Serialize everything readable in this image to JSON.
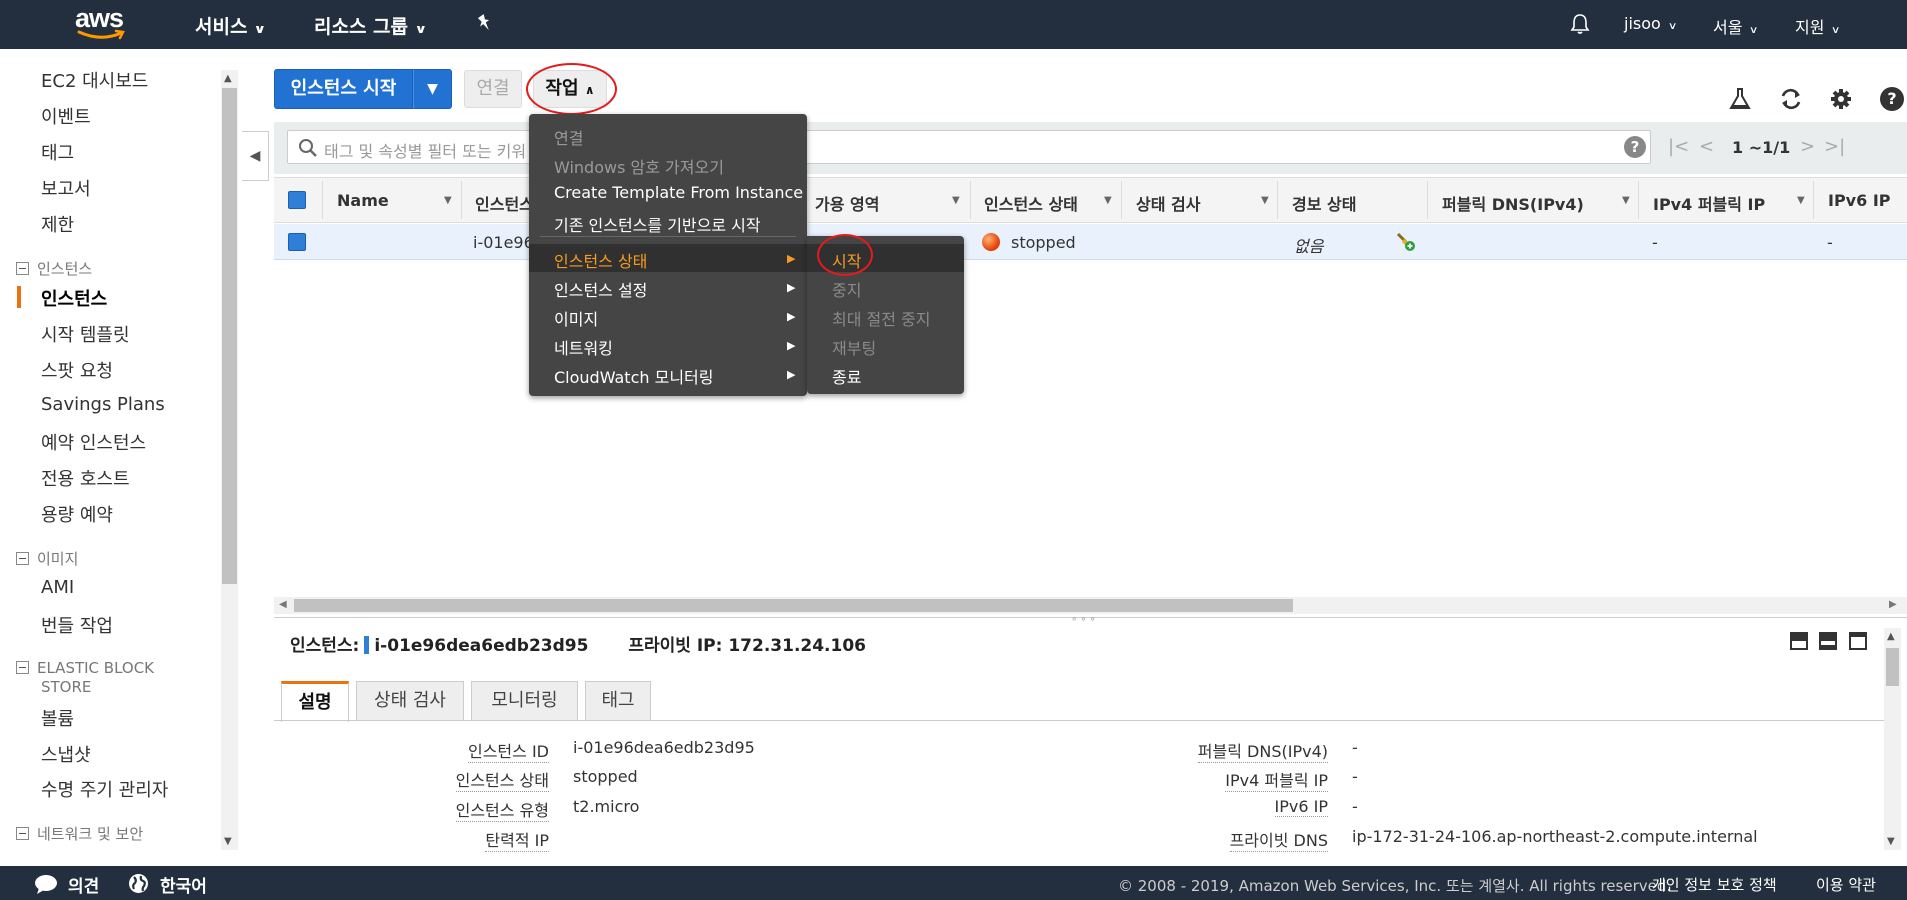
{
  "top_nav": {
    "logo_text": "aws",
    "services": "서비스",
    "resource_groups": "리소스 그룹",
    "user": "jisoo",
    "region": "서울",
    "support": "지원"
  },
  "sidebar": {
    "items_top": [
      "EC2 대시보드",
      "이벤트",
      "태그",
      "보고서",
      "제한"
    ],
    "section_instances": "인스턴스",
    "instances_items": [
      "인스턴스",
      "시작 템플릿",
      "스팟 요청",
      "Savings Plans",
      "예약 인스턴스",
      "전용 호스트",
      "용량 예약"
    ],
    "section_images": "이미지",
    "images_items": [
      "AMI",
      "번들 작업"
    ],
    "section_ebs_line1": "ELASTIC BLOCK",
    "section_ebs_line2": "STORE",
    "ebs_items": [
      "볼륨",
      "스냅샷",
      "수명 주기 관리자"
    ],
    "section_network": "네트워크 및 보안"
  },
  "toolbar": {
    "launch_label": "인스턴스 시작",
    "connect_label": "연결",
    "actions_label": "작업"
  },
  "search": {
    "placeholder": "태그 및 속성별 필터 또는 키워"
  },
  "pager": {
    "text": "1 ~1/1"
  },
  "table": {
    "columns": [
      "Name",
      "인스턴스",
      "가용 영역",
      "인스턴스 상태",
      "상태 검사",
      "경보 상태",
      "퍼블릭 DNS(IPv4)",
      "IPv4 퍼블릭 IP",
      "IPv6 IP"
    ],
    "row": {
      "instance_id": "i-01e96",
      "state": "stopped",
      "alarm": "없음",
      "ipv4": "-",
      "ipv6": "-"
    }
  },
  "actions_menu": {
    "items": [
      {
        "label": "연결",
        "disabled": true
      },
      {
        "label": "Windows 암호 가져오기",
        "disabled": true
      },
      {
        "label": "Create Template From Instance",
        "disabled": false
      },
      {
        "label": "기존 인스턴스를 기반으로 시작",
        "disabled": false
      },
      {
        "label": "인스턴스 상태",
        "submenu": true,
        "highlighted": true
      },
      {
        "label": "인스턴스 설정",
        "submenu": true
      },
      {
        "label": "이미지",
        "submenu": true
      },
      {
        "label": "네트워킹",
        "submenu": true
      },
      {
        "label": "CloudWatch 모니터링",
        "submenu": true
      }
    ]
  },
  "state_submenu": {
    "items": [
      {
        "label": "시작",
        "disabled": false
      },
      {
        "label": "중지",
        "disabled": true
      },
      {
        "label": "최대 절전 중지",
        "disabled": true
      },
      {
        "label": "재부팅",
        "disabled": true
      },
      {
        "label": "종료",
        "disabled": false
      }
    ]
  },
  "detail": {
    "instance_label": "인스턴스:",
    "instance_id": "i-01e96dea6edb23d95",
    "private_ip_label": "프라이빗 IP:",
    "private_ip": "172.31.24.106",
    "tabs": [
      "설명",
      "상태 검사",
      "모니터링",
      "태그"
    ],
    "left_labels": [
      "인스턴스 ID",
      "인스턴스 상태",
      "인스턴스 유형",
      "탄력적 IP"
    ],
    "left_values": [
      "i-01e96dea6edb23d95",
      "stopped",
      "t2.micro",
      ""
    ],
    "right_labels": [
      "퍼블릭 DNS(IPv4)",
      "IPv4 퍼블릭 IP",
      "IPv6 IP",
      "프라이빗 DNS"
    ],
    "right_values": [
      "-",
      "-",
      "-",
      "ip-172-31-24-106.ap-northeast-2.compute.internal"
    ]
  },
  "footer": {
    "feedback": "의견",
    "language": "한국어",
    "copyright": "© 2008 - 2019, Amazon Web Services, Inc. 또는 계열사. All rights reserved.",
    "privacy": "개인 정보 보호 정책",
    "terms": "이용 약관"
  },
  "colors": {
    "nav_bg": "#232f3e",
    "primary_blue": "#2272d4",
    "accent_orange": "#ec7211",
    "menu_bg": "#454545",
    "highlight_text": "#f59b23",
    "annotation_red": "#e31b1b"
  }
}
